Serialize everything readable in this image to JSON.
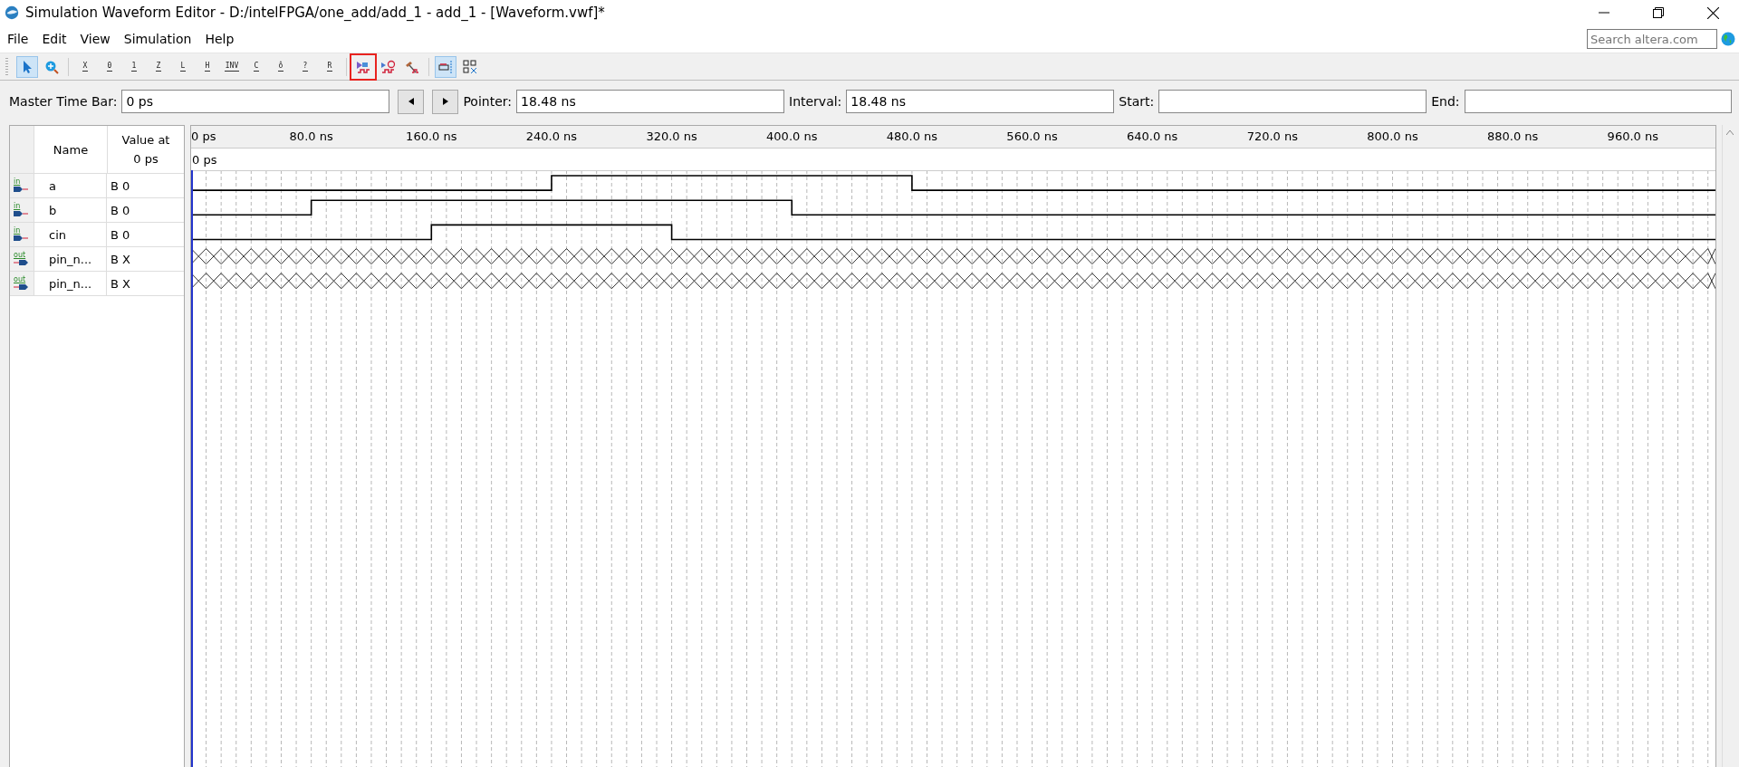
{
  "window": {
    "title": "Simulation Waveform Editor - D:/intelFPGA/one_add/add_1 - add_1 - [Waveform.vwf]*"
  },
  "menu": [
    "File",
    "Edit",
    "View",
    "Simulation",
    "Help"
  ],
  "search": {
    "placeholder": "Search altera.com"
  },
  "toolbar": [
    {
      "kind": "pointer",
      "selected": true,
      "highlighted": false
    },
    {
      "kind": "zoom",
      "selected": false,
      "highlighted": false
    },
    {
      "kind": "separator"
    },
    {
      "kind": "value",
      "label": "X",
      "selected": false,
      "highlighted": false
    },
    {
      "kind": "value",
      "label": "0",
      "selected": false,
      "highlighted": false
    },
    {
      "kind": "value",
      "label": "1",
      "selected": false,
      "highlighted": false
    },
    {
      "kind": "value",
      "label": "Z",
      "selected": false,
      "highlighted": false
    },
    {
      "kind": "value",
      "label": "L",
      "selected": false,
      "highlighted": false
    },
    {
      "kind": "value",
      "label": "H",
      "selected": false,
      "highlighted": false
    },
    {
      "kind": "value",
      "label": "INV",
      "selected": false,
      "highlighted": false
    },
    {
      "kind": "value",
      "label": "C",
      "selected": false,
      "highlighted": false
    },
    {
      "kind": "value",
      "label": "ô",
      "selected": false,
      "highlighted": false
    },
    {
      "kind": "value",
      "label": "?",
      "selected": false,
      "highlighted": false
    },
    {
      "kind": "value",
      "label": "R",
      "selected": false,
      "highlighted": false
    },
    {
      "kind": "separator"
    },
    {
      "kind": "run",
      "selected": false,
      "highlighted": true
    },
    {
      "kind": "timing",
      "selected": false,
      "highlighted": false
    },
    {
      "kind": "hammer",
      "selected": false,
      "highlighted": false
    },
    {
      "kind": "separator"
    },
    {
      "kind": "snap",
      "selected": true,
      "highlighted": false
    },
    {
      "kind": "grid",
      "selected": false,
      "highlighted": false
    }
  ],
  "time_bar": {
    "master_label": "Master Time Bar:",
    "master_value": "0 ps",
    "pointer_label": "Pointer:",
    "pointer_value": "18.48 ns",
    "interval_label": "Interval:",
    "interval_value": "18.48 ns",
    "start_label": "Start:",
    "end_label": "End:"
  },
  "signal_table": {
    "columns": [
      "Name",
      "Value at\n0 ps"
    ],
    "rows": [
      {
        "direction": "in",
        "name": "a",
        "value": "B 0"
      },
      {
        "direction": "in",
        "name": "b",
        "value": "B 0"
      },
      {
        "direction": "in",
        "name": "cin",
        "value": "B 0"
      },
      {
        "direction": "out",
        "name": "pin_n...",
        "value": "B X"
      },
      {
        "direction": "out",
        "name": "pin_n...",
        "value": "B X"
      }
    ]
  },
  "waveform": {
    "cursor_label": "0 ps",
    "ruler": [
      "0 ps",
      "80.0 ns",
      "160.0 ns",
      "240.0 ns",
      "320.0 ns",
      "400.0 ns",
      "480.0 ns",
      "560.0 ns",
      "640.0 ns",
      "720.0 ns",
      "800.0 ns",
      "880.0 ns",
      "960.0 ns"
    ]
  }
}
